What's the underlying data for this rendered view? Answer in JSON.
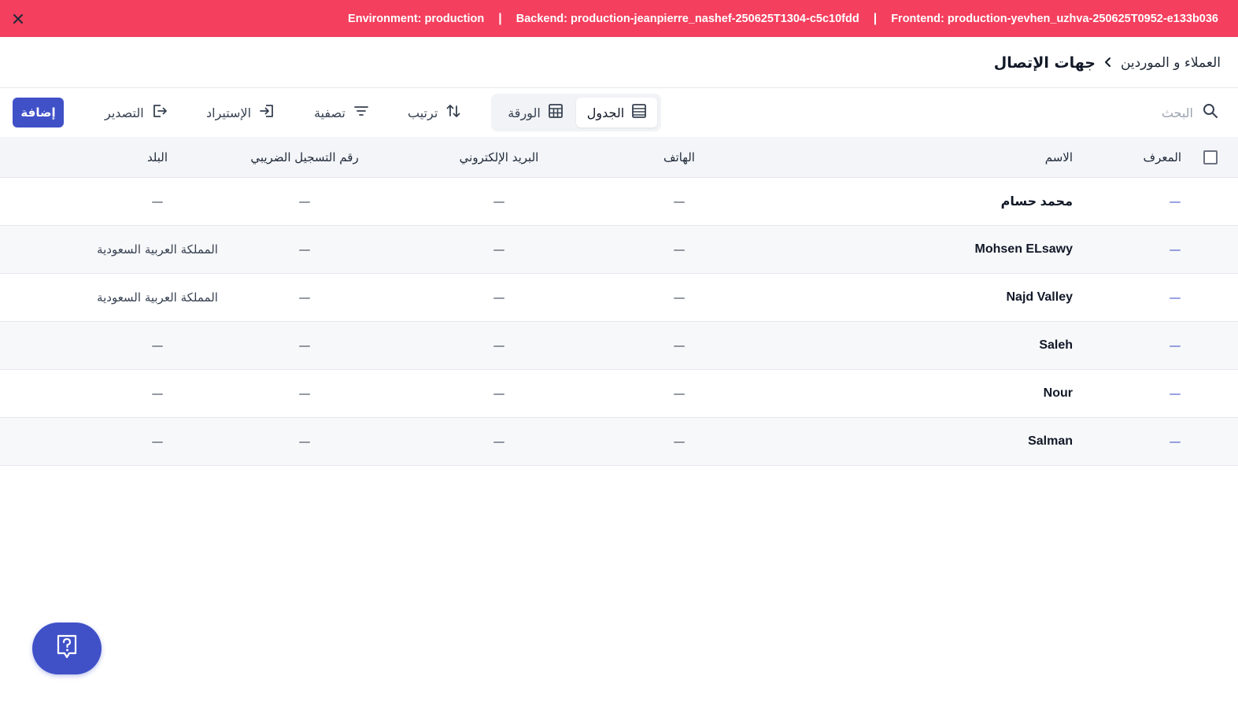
{
  "env_bar": {
    "environment": "Environment: production",
    "separator": "|",
    "backend": "Backend: production-jeanpierre_nashef-250625T1304-c5c10fdd",
    "frontend": "Frontend: production-yevhen_uzhva-250625T0952-e133b036"
  },
  "breadcrumb": {
    "parent": "العملاء و الموردين",
    "current": "جهات الإتصال"
  },
  "toolbar": {
    "search_placeholder": "البحث",
    "view_table": "الجدول",
    "view_sheet": "الورقة",
    "sort": "ترتيب",
    "filter": "تصفية",
    "import": "الإستيراد",
    "export": "التصدير",
    "add": "إضافة"
  },
  "table": {
    "headers": {
      "id": "المعرف",
      "name": "الاسم",
      "phone": "الهاتف",
      "email": "البريد الإلكتروني",
      "tax": "رقم التسجيل الضريبي",
      "country": "البلد"
    },
    "rows": [
      {
        "id": "—",
        "name": "محمد حسام",
        "phone": "—",
        "email": "—",
        "tax": "—",
        "country": "—"
      },
      {
        "id": "—",
        "name": "Mohsen ELsawy",
        "phone": "—",
        "email": "—",
        "tax": "—",
        "country": "المملكة العربية السعودية"
      },
      {
        "id": "—",
        "name": "Najd Valley",
        "phone": "—",
        "email": "—",
        "tax": "—",
        "country": "المملكة العربية السعودية"
      },
      {
        "id": "—",
        "name": "Saleh",
        "phone": "—",
        "email": "—",
        "tax": "—",
        "country": "—"
      },
      {
        "id": "—",
        "name": "Nour",
        "phone": "—",
        "email": "—",
        "tax": "—",
        "country": "—"
      },
      {
        "id": "—",
        "name": "Salman",
        "phone": "—",
        "email": "—",
        "tax": "—",
        "country": "—"
      }
    ]
  },
  "colors": {
    "env_bar": "#f43f5e",
    "primary": "#4051c8",
    "header_bg": "#f3f5f9",
    "alt_row_bg": "#f7f8fa"
  },
  "icons": {
    "close": "close-icon",
    "breadcrumb_separator": "chevron-left-icon",
    "search": "search-icon",
    "table_view": "list-view-icon",
    "sheet_view": "grid-view-icon",
    "sort": "sort-arrows-icon",
    "filter": "filter-lines-icon",
    "import": "import-icon",
    "export": "export-icon",
    "help": "help-question-icon"
  }
}
